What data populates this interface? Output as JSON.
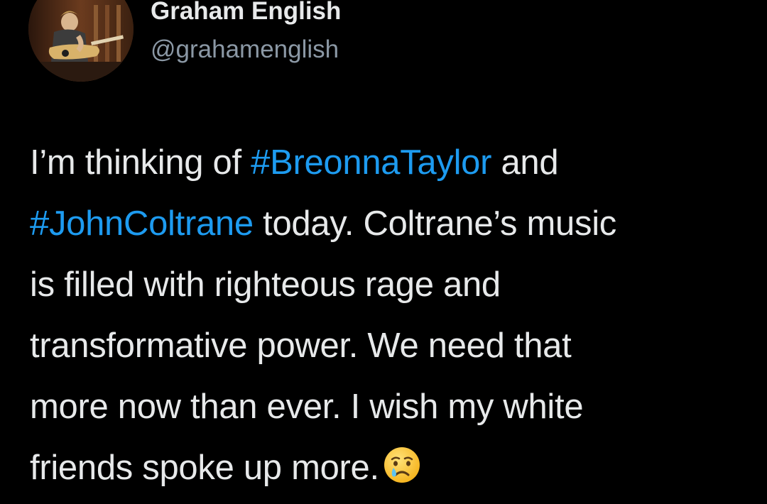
{
  "author": {
    "display_name": "Graham English",
    "handle": "@grahamenglish",
    "avatar_icon": "guitarist-profile-photo"
  },
  "tweet": {
    "line1": {
      "prefix": "I’m thinking of ",
      "hashtag": "#BreonnaTaylor",
      "suffix": " and"
    },
    "line2": {
      "hashtag": "#JohnColtrane",
      "suffix": " today. Coltrane’s music"
    },
    "line3": "is filled with righteous rage and",
    "line4": "transformative power. We need that",
    "line5": "more now than ever. I wish my white",
    "line6": "friends spoke up more.",
    "emoji": "crying-face-emoji"
  },
  "colors": {
    "background": "#000000",
    "text": "#e7e9ea",
    "secondary_text": "#8b98a5",
    "link": "#1d9bf0"
  }
}
